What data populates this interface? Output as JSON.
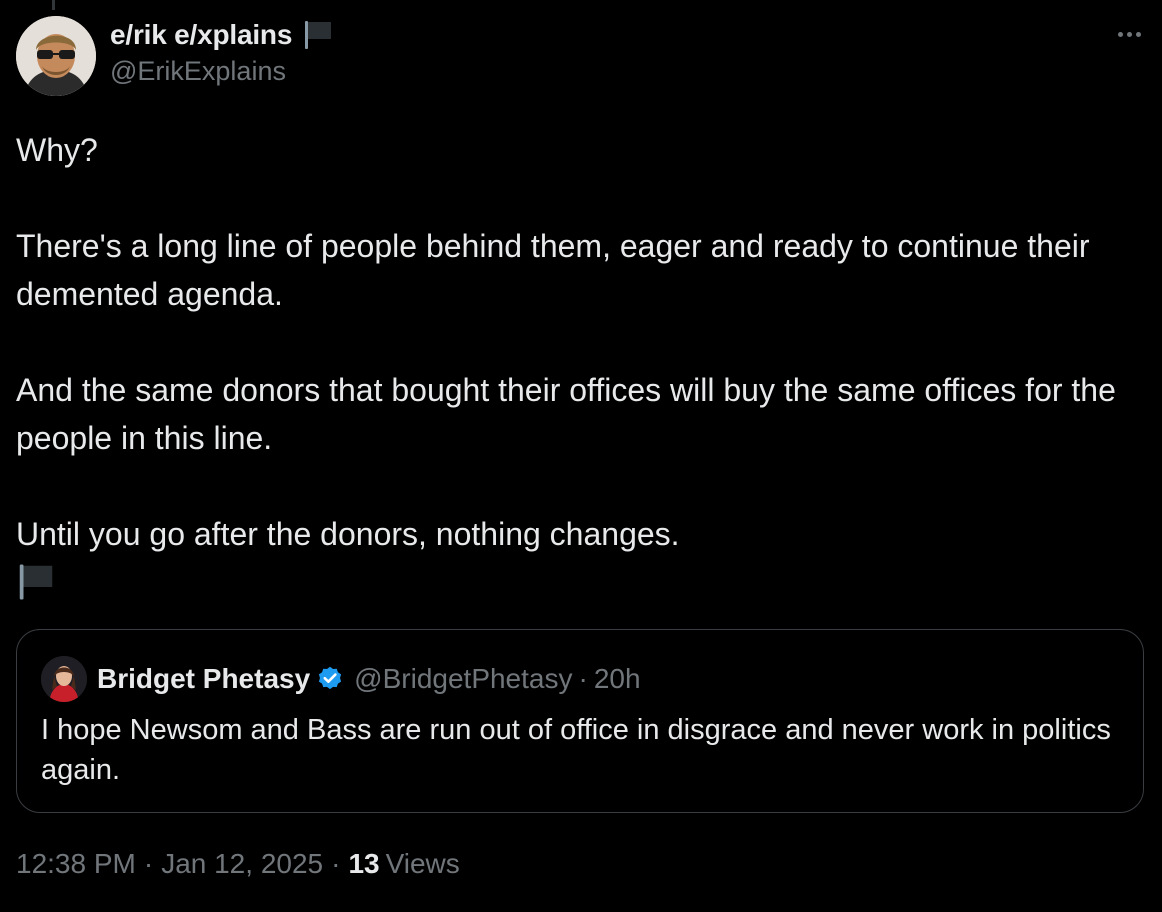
{
  "author": {
    "display_name": "e/rik e/xplains",
    "handle": "@ErikExplains",
    "name_emoji_icon": "black-flag-icon"
  },
  "tweet": {
    "paragraphs": [
      "Why?",
      "There's a long line of people behind them, eager and ready to continue their demented agenda.",
      "And the same donors that bought their offices will buy the same offices for the people in this line.",
      "Until you go after the donors, nothing changes."
    ],
    "trailing_emoji_icon": "black-flag-icon"
  },
  "quoted_tweet": {
    "display_name": "Bridget Phetasy",
    "verified_icon": "verified-badge-icon",
    "handle": "@BridgetPhetasy",
    "separator": "·",
    "time_ago": "20h",
    "text": "I hope Newsom and Bass are run out of office in disgrace and never work in politics again."
  },
  "meta": {
    "time": "12:38 PM",
    "separator": "·",
    "date": "Jan 12, 2025",
    "views_count": "13",
    "views_label": "Views"
  },
  "colors": {
    "background": "#000000",
    "primary_text": "#e7e9ea",
    "secondary_text": "#71767b",
    "border": "#3a3d41",
    "verified_blue": "#1d9bf0"
  }
}
